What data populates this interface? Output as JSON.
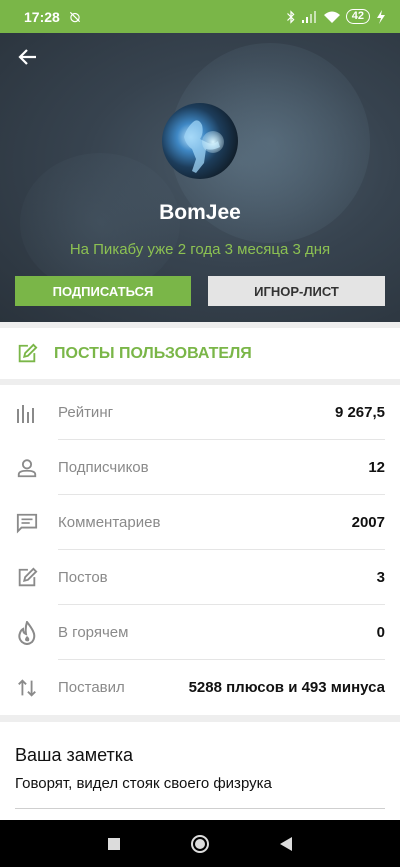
{
  "status_bar": {
    "time": "17:28",
    "battery": "42"
  },
  "profile": {
    "username": "BomJee",
    "member_since": "На Пикабу уже 2 года 3 месяца 3 дня",
    "subscribe_label": "ПОДПИСАТЬСЯ",
    "ignore_label": "ИГНОР-ЛИСТ"
  },
  "posts_link": {
    "label": "ПОСТЫ ПОЛЬЗОВАТЕЛЯ"
  },
  "stats": [
    {
      "icon": "bar-chart-icon",
      "label": "Рейтинг",
      "value": "9 267,5"
    },
    {
      "icon": "person-icon",
      "label": "Подписчиков",
      "value": "12"
    },
    {
      "icon": "comment-icon",
      "label": "Комментариев",
      "value": "2007"
    },
    {
      "icon": "edit-icon",
      "label": "Постов",
      "value": "3"
    },
    {
      "icon": "flame-icon",
      "label": "В горячем",
      "value": "0"
    },
    {
      "icon": "swap-vertical-icon",
      "label": "Поставил",
      "value": "5288 плюсов и 493 минуса"
    }
  ],
  "note": {
    "title": "Ваша заметка",
    "text": "Говорят, видел стояк своего физрука"
  },
  "colors": {
    "accent": "#7ab648",
    "accent_text": "#8cc152"
  }
}
